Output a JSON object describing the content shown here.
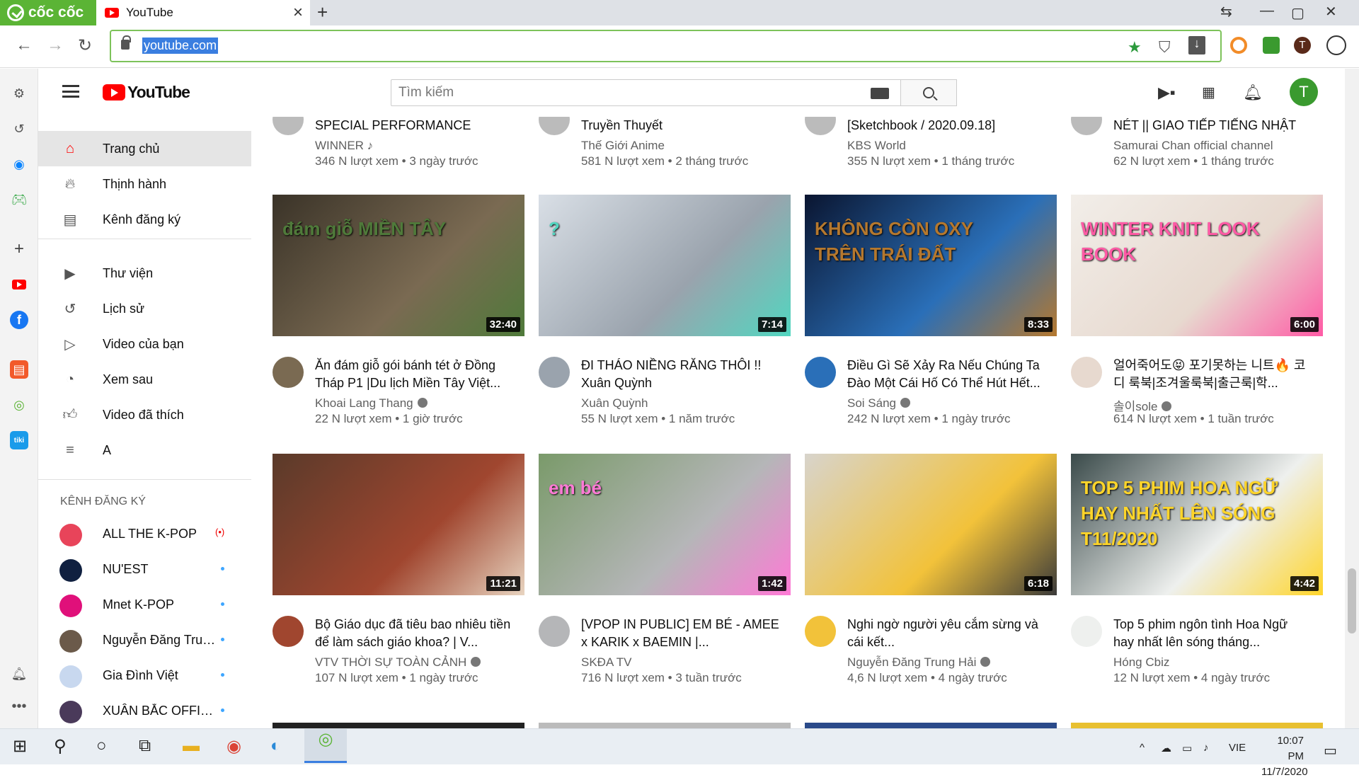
{
  "browser": {
    "brand": "cốc cốc",
    "tab_title": "YouTube",
    "url": "youtube.com",
    "colors": {
      "brand": "#5bb435",
      "accent": "#3a7ee0"
    }
  },
  "youtube": {
    "logo_text": "YouTube",
    "search_placeholder": "Tìm kiếm",
    "avatar_letter": "T",
    "guide": [
      {
        "label": "Trang chủ",
        "icon": "home-icon",
        "active": true
      },
      {
        "label": "Thịnh hành",
        "icon": "trending-icon"
      },
      {
        "label": "Kênh đăng ký",
        "icon": "subscriptions-icon"
      },
      {
        "label": "Thư viện",
        "icon": "library-icon"
      },
      {
        "label": "Lịch sử",
        "icon": "history-icon"
      },
      {
        "label": "Video của bạn",
        "icon": "your-videos-icon"
      },
      {
        "label": "Xem sau",
        "icon": "watch-later-icon"
      },
      {
        "label": "Video đã thích",
        "icon": "liked-icon"
      },
      {
        "label": "A",
        "icon": "playlist-icon"
      }
    ],
    "subs_heading": "KÊNH ĐĂNG KÝ",
    "subscriptions": [
      {
        "name": "ALL THE K-POP",
        "live": "(•)",
        "color": "#e8445a"
      },
      {
        "name": "NU'EST",
        "color": "#102040"
      },
      {
        "name": "Mnet K-POP",
        "color": "#e0107a"
      },
      {
        "name": "Nguyễn Đăng Trun...",
        "color": "#6b5a4a"
      },
      {
        "name": "Gia Đình Việt",
        "color": "#c8d8ef"
      },
      {
        "name": "XUÂN BẮC OFFICI...",
        "color": "#4a3a5a"
      }
    ]
  },
  "videos_partial": [
    {
      "title": "SPECIAL PERFORMANCE VIDEO",
      "channel": "WINNER ♪",
      "meta": "346 N lượt xem • 3 ngày trước"
    },
    {
      "title": "Truyền Thuyết",
      "channel": "Thế Giới Anime",
      "meta": "581 N lượt xem • 2 tháng trước"
    },
    {
      "title": "[Sketchbook / 2020.09.18]",
      "channel": "KBS World",
      "meta": "355 N lượt xem • 1 tháng trước"
    },
    {
      "title": "NÉT || GIAO TIẾP TIẾNG NHẬT ||...",
      "channel": "Samurai Chan official channel",
      "meta": "62 N lượt xem • 1 tháng trước"
    }
  ],
  "videos": [
    {
      "title": "Ăn đám giỗ gói bánh tét ở Đồng Tháp P1 |Du lịch Miền Tây Việt...",
      "channel": "Khoai Lang Thang",
      "verified": true,
      "meta": "22 N lượt xem • 1 giờ trước",
      "duration": "32:40",
      "thumb_text": "đám giỗ MIỀN TÂY",
      "colors": [
        "#3a3328",
        "#7a6a52",
        "#4f7a3a"
      ]
    },
    {
      "title": "ĐI THÁO NIỀNG RĂNG THÔI !! Xuân Quỳnh",
      "channel": "Xuân Quỳnh",
      "verified": false,
      "meta": "55 N lượt xem • 1 năm trước",
      "duration": "7:14",
      "thumb_text": "?",
      "colors": [
        "#d9dfe6",
        "#9aa3ad",
        "#52d6c0"
      ]
    },
    {
      "title": "Điều Gì Sẽ Xảy Ra Nếu Chúng Ta Đào Một Cái Hố Có Thể Hút Hết...",
      "channel": "Soi Sáng",
      "verified": true,
      "meta": "242 N lượt xem • 1 ngày trước",
      "duration": "8:33",
      "thumb_text": "KHÔNG CÒN OXY TRÊN TRÁI ĐẤT",
      "colors": [
        "#0a1530",
        "#2a6fb8",
        "#b5782e"
      ]
    },
    {
      "title": "얼어죽어도😝 포기못하는 니트🔥 코디 룩북|조겨울룩북|출근룩|학...",
      "channel": "솔이sole",
      "verified": true,
      "meta": "614 N lượt xem • 1 tuần trước",
      "duration": "6:00",
      "thumb_text": "WINTER KNIT LOOK BOOK",
      "colors": [
        "#f2eee9",
        "#e7d9cf",
        "#ff5aa5"
      ]
    },
    {
      "title": "Bộ Giáo dục đã tiêu bao nhiêu tiền để làm sách giáo khoa? | V...",
      "channel": "VTV THỜI SỰ TOÀN CẢNH",
      "verified": true,
      "meta": "107 N lượt xem • 1 ngày trước",
      "duration": "11:21",
      "thumb_text": "",
      "colors": [
        "#5a3a2a",
        "#a0462f",
        "#e8d4c0"
      ]
    },
    {
      "title": "[VPOP IN PUBLIC] EM BÉ - AMEE x KARIK x BAEMIN |...",
      "channel": "SKĐA TV",
      "verified": false,
      "meta": "716 N lượt xem • 3 tuần trước",
      "duration": "1:42",
      "thumb_text": "em bé",
      "colors": [
        "#7a9a6a",
        "#b5b6b8",
        "#ff7ad6"
      ]
    },
    {
      "title": "Nghi ngờ người yêu cắm sừng và cái kết...",
      "channel": "Nguyễn Đăng Trung Hải",
      "verified": true,
      "meta": "4,6 N lượt xem • 4 ngày trước",
      "duration": "6:18",
      "thumb_text": "",
      "colors": [
        "#d8d4cc",
        "#f2c23a",
        "#3a3a3a"
      ]
    },
    {
      "title": "Top 5 phim ngôn tình Hoa Ngữ hay nhất lên sóng tháng...",
      "channel": "Hóng Cbiz",
      "verified": false,
      "meta": "12 N lượt xem • 4 ngày trước",
      "duration": "4:42",
      "thumb_text": "TOP 5 PHIM HOA NGỮ HAY NHẤT LÊN SÓNG T11/2020",
      "colors": [
        "#3a4a4a",
        "#eef0ee",
        "#ffd52a"
      ]
    }
  ],
  "taskbar": {
    "lang": "VIE",
    "time": "10:07 PM",
    "date": "11/7/2020"
  }
}
